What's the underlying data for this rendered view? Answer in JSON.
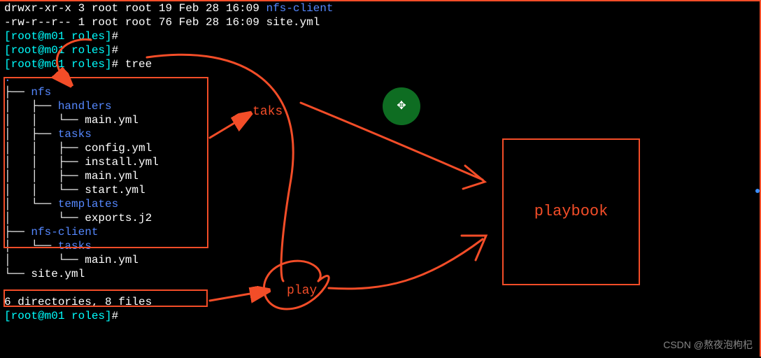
{
  "lines": {
    "l0a": "drwxr-xr-x 3 root root 19 Feb 28 16:09 ",
    "l0b": "nfs-client",
    "l1": "-rw-r--r-- 1 root root 76 Feb 28 16:09 site.yml",
    "prompt_user": "[root@m01 roles]",
    "prompt_hash": "#",
    "cmd_tree": " tree",
    "dot": ".",
    "t_nfs": "├── ",
    "nfs": "nfs",
    "t_handlers": "│   ├── ",
    "handlers": "handlers",
    "t_h_main": "│   │   └── main.yml",
    "t_tasks": "│   ├── ",
    "tasks": "tasks",
    "t_config": "│   │   ├── config.yml",
    "t_install": "│   │   ├── install.yml",
    "t_t_main": "│   │   ├── main.yml",
    "t_start": "│   │   └── start.yml",
    "t_templates": "│   └── ",
    "templates": "templates",
    "t_exports": "│       └── exports.j2",
    "t_nfsclient": "├── ",
    "nfsclient": "nfs-client",
    "t_nc_tasks": "│   └── ",
    "nc_tasks": "tasks",
    "t_nc_main": "│       └── main.yml",
    "t_site": "└── site.yml",
    "summary": "6 directories, 8 files"
  },
  "annotations": {
    "taks": "taks",
    "play": "play",
    "playbook": "playbook",
    "cursor": "✥"
  },
  "watermark": "CSDN @熬夜泡枸杞"
}
